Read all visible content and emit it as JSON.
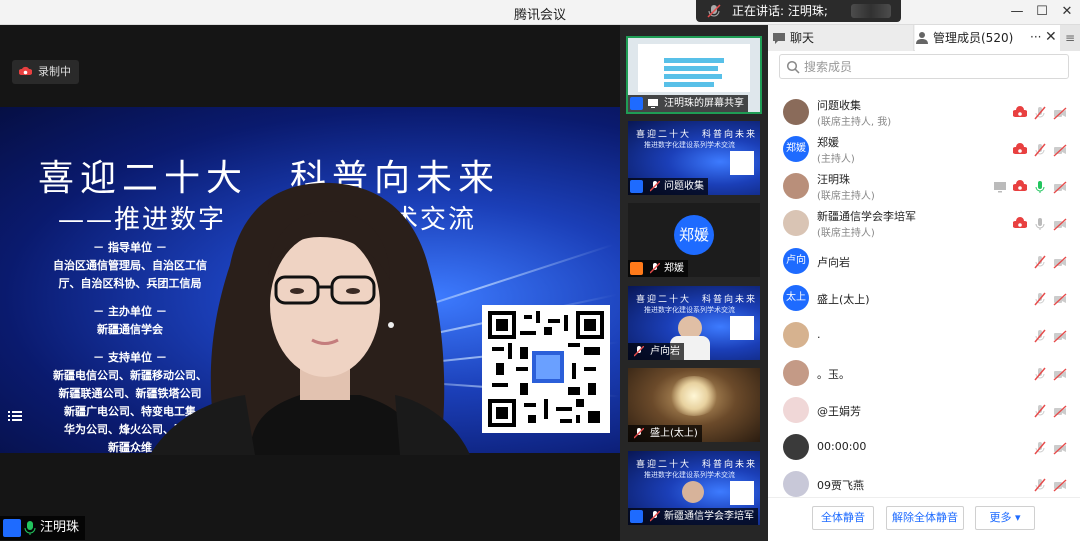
{
  "window": {
    "title": "腾讯会议"
  },
  "speaking": {
    "label": "正在讲话: 汪明珠;"
  },
  "recording": {
    "label": "录制中"
  },
  "slide": {
    "title": "喜迎二十大　科普向未来",
    "subtitle": "——推进数字",
    "subtitle_tail": "列学术交流",
    "lines": [
      "－ 指导单位 －",
      "自治区通信管理局、自治区工信",
      "厅、自治区科协、兵团工信局",
      "－ 主办单位 －",
      "新疆通信学会",
      "－ 支持单位 －",
      "新疆电信公司、新疆移动公司、",
      "新疆联通公司、新疆铁塔公司",
      "新疆广电公司、特变电工集",
      "华为公司、烽火公司、腾讯",
      "新疆众维"
    ]
  },
  "main_video": {
    "name": "汪明珠"
  },
  "thumbnails": [
    {
      "label": "汪明珠的屏幕共享"
    },
    {
      "label": "问题收集"
    },
    {
      "label": "郑媛",
      "avatar": "郑媛"
    },
    {
      "label": "卢向岩"
    },
    {
      "label": "盛上(太上)"
    },
    {
      "label": "新疆通信学会李培军"
    }
  ],
  "mini_slide": {
    "title": "喜迎二十大　科普向未来",
    "sub": "推进数字化建设系列学术交流"
  },
  "panel": {
    "tab_chat": "聊天",
    "tab_members": "管理成员(520)",
    "more": "···",
    "close": "✕",
    "toggle": "≡",
    "search_placeholder": "搜索成员"
  },
  "members": [
    {
      "name": "问题收集",
      "role": "(联席主持人, 我)",
      "avatar": ""
    },
    {
      "name": "郑媛",
      "role": "(主持人)",
      "avatar": "郑媛"
    },
    {
      "name": "汪明珠",
      "role": "(联席主持人)",
      "avatar": ""
    },
    {
      "name": "新疆通信学会李培军",
      "role": "(联席主持人)",
      "avatar": ""
    },
    {
      "name": "卢向岩",
      "role": "",
      "avatar": "卢向岩"
    },
    {
      "name": "盛上(太上)",
      "role": "",
      "avatar": "太上"
    },
    {
      "name": ".",
      "role": "",
      "avatar": ""
    },
    {
      "name": "。玉。",
      "role": "",
      "avatar": ""
    },
    {
      "name": "@王娟芳",
      "role": "",
      "avatar": ""
    },
    {
      "name": "00:00:00",
      "role": "",
      "avatar": ""
    },
    {
      "name": "09贾飞燕",
      "role": "",
      "avatar": ""
    }
  ],
  "footer": {
    "mute_all": "全体静音",
    "unmute_all": "解除全体静音",
    "more": "更多 ▾"
  },
  "colors": {
    "accent": "#1e6bff",
    "mic_active": "#1f9d55",
    "muted": "#e64c4c",
    "recording": "#e84040"
  },
  "icons": [
    "mic-icon",
    "user-icon",
    "recording-icon",
    "search-icon",
    "screen-share-icon",
    "camera-off-icon",
    "mic-muted-icon",
    "chat-icon",
    "members-icon"
  ]
}
